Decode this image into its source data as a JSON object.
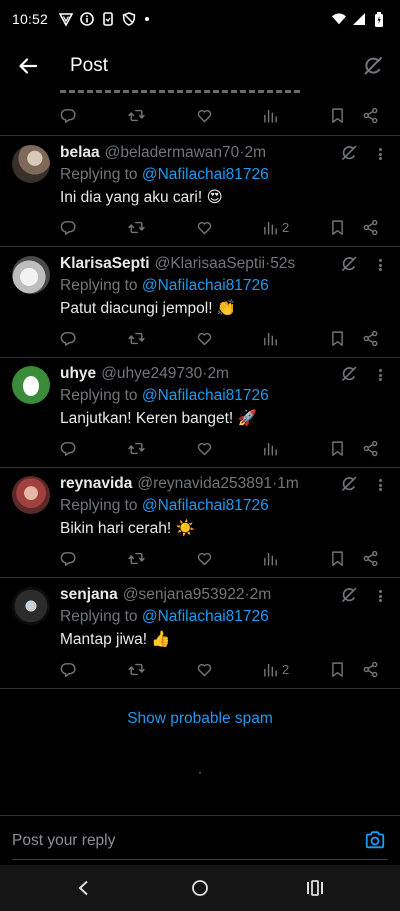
{
  "status_bar": {
    "time": "10:52"
  },
  "header": {
    "title": "Post"
  },
  "replies": [
    {
      "name": "belaa",
      "handle": "@beladermawan70",
      "time": "2m",
      "replying_prefix": "Replying to ",
      "replying_to": "@Nafilachai81726",
      "text": "Ini dia yang aku cari! 😍",
      "views": "2"
    },
    {
      "name": "KlarisaSepti",
      "handle": "@KlarisaaSeptii",
      "time": "52s",
      "replying_prefix": "Replying to ",
      "replying_to": "@Nafilachai81726",
      "text": "Patut diacungi jempol! 👏",
      "views": ""
    },
    {
      "name": "uhye",
      "handle": "@uhye249730",
      "time": "2m",
      "replying_prefix": "Replying to ",
      "replying_to": "@Nafilachai81726",
      "text": "Lanjutkan! Keren banget! 🚀",
      "views": ""
    },
    {
      "name": "reynavida",
      "handle": "@reynavida253891",
      "time": "1m",
      "replying_prefix": "Replying to ",
      "replying_to": "@Nafilachai81726",
      "text": "Bikin hari cerah! ☀️",
      "views": ""
    },
    {
      "name": "senjana",
      "handle": "@senjana953922",
      "time": "2m",
      "replying_prefix": "Replying to ",
      "replying_to": "@Nafilachai81726",
      "text": "Mantap jiwa! 👍",
      "views": "2"
    }
  ],
  "separator": " · ",
  "show_spam_label": "Show probable spam",
  "composer": {
    "placeholder": "Post your reply"
  },
  "icons": {
    "reply": "reply-icon",
    "repost": "repost-icon",
    "like": "heart-icon",
    "views": "views-icon",
    "bookmark": "bookmark-icon",
    "share": "share-icon",
    "grok": "grok-icon",
    "more": "more-icon",
    "camera": "camera-icon"
  },
  "colors": {
    "background": "#000000",
    "accent": "#1d9bf0",
    "muted": "#71767b",
    "text": "#e7e9ea",
    "divider": "#2f3336"
  }
}
